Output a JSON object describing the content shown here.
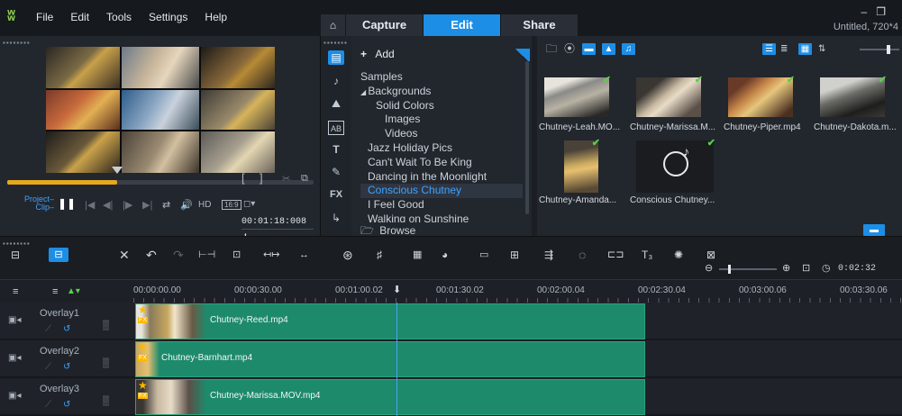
{
  "menu": {
    "items": [
      "File",
      "Edit",
      "Tools",
      "Settings",
      "Help"
    ]
  },
  "tabs": {
    "capture": "Capture",
    "edit": "Edit",
    "share": "Share"
  },
  "window": {
    "title": "Untitled, 720*4"
  },
  "player": {
    "project_label": "Project–",
    "clip_label": "Clip–",
    "hd_label": "HD",
    "ratio_label": "16:9",
    "timecode": "00:01:18:008",
    "scrub_progress": 0.36
  },
  "library": {
    "add_label": "Add",
    "folders": [
      {
        "label": "Samples",
        "indent": 0,
        "selected": false
      },
      {
        "label": "Backgrounds",
        "indent": 0,
        "selected": false,
        "expanded": true
      },
      {
        "label": "Solid Colors",
        "indent": 2,
        "selected": false
      },
      {
        "label": "Images",
        "indent": 2,
        "selected": false
      },
      {
        "label": "Videos",
        "indent": 2,
        "selected": false
      },
      {
        "label": "Jazz Holiday Pics",
        "indent": 0,
        "selected": false
      },
      {
        "label": "Can't Wait To Be King",
        "indent": 0,
        "selected": false
      },
      {
        "label": "Dancing in the Moonlight",
        "indent": 0,
        "selected": false
      },
      {
        "label": "Conscious Chutney",
        "indent": 0,
        "selected": true
      },
      {
        "label": "I Feel Good",
        "indent": 0,
        "selected": false
      },
      {
        "label": "Walking on Sunshine",
        "indent": 0,
        "selected": false
      }
    ],
    "browse_label": "Browse",
    "media": [
      {
        "label": "Chutney-Leah.MO..."
      },
      {
        "label": "Chutney-Marissa.M..."
      },
      {
        "label": "Chutney-Piper.mp4"
      },
      {
        "label": "Chutney-Dakota.m..."
      },
      {
        "label": "Chutney-Amanda..."
      },
      {
        "label": "Conscious Chutney..."
      }
    ]
  },
  "timeline": {
    "ruler_ticks": [
      "00:00:00.00",
      "00:00:30.00",
      "00:01:00.02",
      "00:01:30.02",
      "00:02:00.04",
      "00:02:30.04",
      "00:03:00.06",
      "00:03:30.06"
    ],
    "zoom_timecode": "0:02:32",
    "tracks": [
      {
        "name": "Overlay1",
        "clip": "Chutney-Reed.mp4"
      },
      {
        "name": "Overlay2",
        "clip": "Chutney-Barnhart.mp4"
      },
      {
        "name": "Overlay3",
        "clip": "Chutney-Marissa.MOV.mp4"
      }
    ]
  },
  "colors": {
    "accent": "#1d8ee6",
    "clip": "#1e8a6c",
    "highlight": "#3fa3ff",
    "scrub": "#e6a81f"
  }
}
